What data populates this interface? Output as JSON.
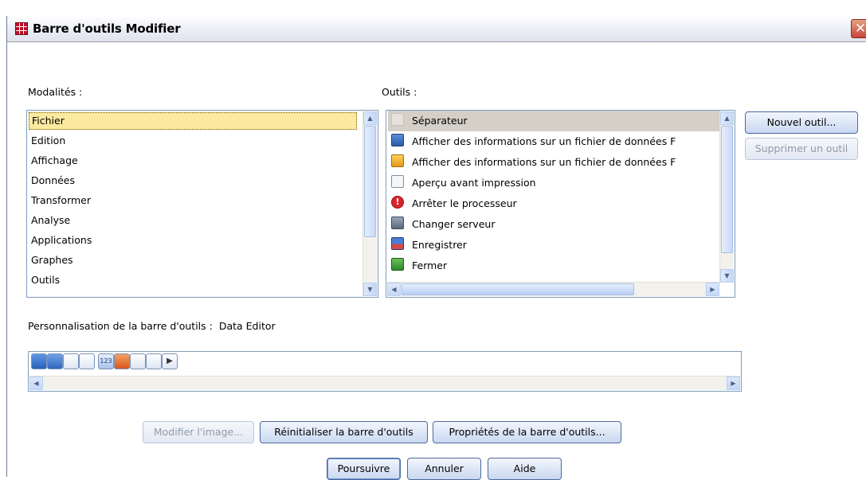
{
  "window": {
    "title": "Barre d'outils Modifier"
  },
  "modalites": {
    "label": "Modalités :",
    "items": [
      "Fichier",
      "Edition",
      "Affichage",
      "Données",
      "Transformer",
      "Analyse",
      "Applications",
      "Graphes",
      "Outils"
    ],
    "selected_index": 0
  },
  "outils": {
    "label": "Outils :",
    "items": [
      {
        "label": "Séparateur",
        "icon": "separator-icon"
      },
      {
        "label": "Afficher des informations sur un fichier de données F",
        "icon": "computer-info-icon"
      },
      {
        "label": "Afficher des informations sur un fichier de données F",
        "icon": "file-info-icon"
      },
      {
        "label": "Aperçu avant impression",
        "icon": "print-preview-icon"
      },
      {
        "label": "Arrêter le processeur",
        "icon": "stop-processor-icon"
      },
      {
        "label": "Changer serveur",
        "icon": "change-server-icon"
      },
      {
        "label": "Enregistrer",
        "icon": "save-icon"
      },
      {
        "label": "Fermer",
        "icon": "close-file-icon"
      }
    ]
  },
  "side_buttons": {
    "new_tool": "Nouvel outil...",
    "delete_tool": "Supprimer un outil"
  },
  "customization": {
    "label": "Personnalisation de la barre d'outils :",
    "editor_name": "Data Editor",
    "toolbar_icons": [
      "data-grid-icon",
      "variable-grid-icon",
      "blank-icon",
      "value-labels-icon",
      "split-file-icon",
      "blank-icon",
      "run-icon"
    ]
  },
  "action_buttons": {
    "modify_image": "Modifier l'image...",
    "reset_toolbar": "Réinitialiser la barre d'outils",
    "toolbar_properties": "Propriétés de la barre d'outils..."
  },
  "dialog_buttons": {
    "continue": "Poursuivre",
    "cancel": "Annuler",
    "help": "Aide"
  },
  "colors": {
    "selection": "#fbeaa0",
    "list_selection_gray": "#d4d0c8",
    "border": "#7f9db9"
  }
}
